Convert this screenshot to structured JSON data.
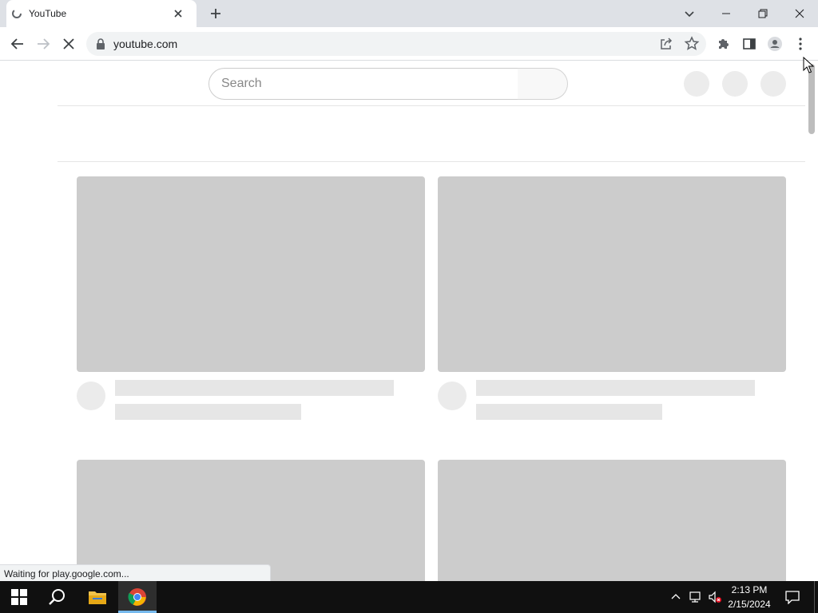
{
  "browser": {
    "tab_title": "YouTube",
    "url": "youtube.com",
    "status_text": "Waiting for play.google.com..."
  },
  "youtube": {
    "search_placeholder": "Search"
  },
  "taskbar": {
    "time": "2:13 PM",
    "date": "2/15/2024"
  },
  "colors": {
    "tabstrip_bg": "#dee1e6",
    "skeleton_thumb": "#cccccc",
    "taskbar_bg": "#101010"
  },
  "icons": [
    "tab-loading-icon",
    "close-icon",
    "plus-icon",
    "chevron-down-icon",
    "minimize-icon",
    "restore-icon",
    "back-icon",
    "forward-icon",
    "stop-icon",
    "lock-icon",
    "share-icon",
    "star-icon",
    "puzzle-icon",
    "side-panel-icon",
    "profile-icon",
    "kebab-menu-icon",
    "windows-icon",
    "search-icon",
    "folder-icon",
    "chrome-icon",
    "chevron-up-icon",
    "network-icon",
    "volume-muted-icon",
    "notification-icon"
  ]
}
